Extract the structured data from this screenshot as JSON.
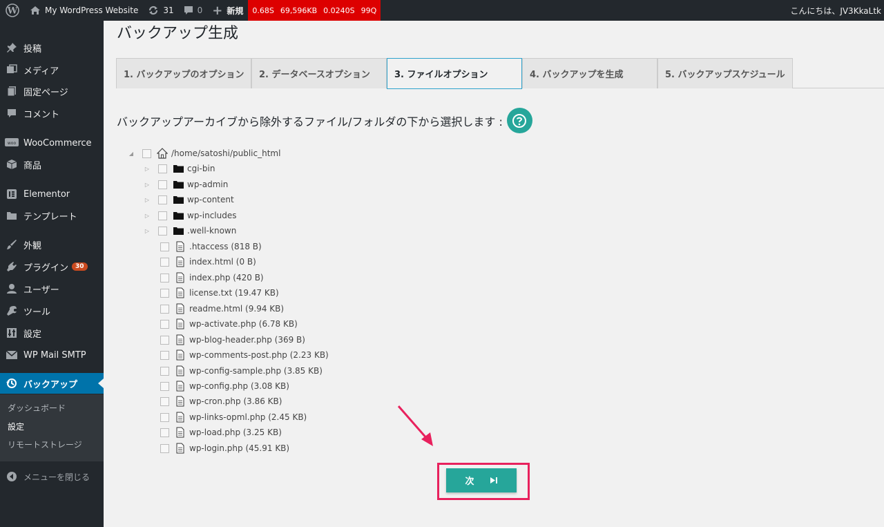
{
  "adminbar": {
    "site_name": "My WordPress Website",
    "updates": "31",
    "comments": "0",
    "new_label": "新規",
    "perf": [
      "0.68S",
      "69,596KB",
      "0.0240S",
      "99Q"
    ],
    "greeting": "こんにちは、JV3KkaLtk"
  },
  "sidebar": {
    "items": [
      {
        "label": "投稿",
        "icon": "pin-icon"
      },
      {
        "label": "メディア",
        "icon": "media-icon"
      },
      {
        "label": "固定ページ",
        "icon": "page-icon"
      },
      {
        "label": "コメント",
        "icon": "comment-icon"
      },
      {
        "label": "WooCommerce",
        "icon": "woo-icon"
      },
      {
        "label": "商品",
        "icon": "box-icon"
      },
      {
        "label": "Elementor",
        "icon": "elementor-icon"
      },
      {
        "label": "テンプレート",
        "icon": "folder-icon"
      },
      {
        "label": "外観",
        "icon": "brush-icon"
      },
      {
        "label": "プラグイン",
        "icon": "plugin-icon",
        "badge": "30"
      },
      {
        "label": "ユーザー",
        "icon": "user-icon"
      },
      {
        "label": "ツール",
        "icon": "wrench-icon"
      },
      {
        "label": "設定",
        "icon": "settings-icon"
      },
      {
        "label": "WP Mail SMTP",
        "icon": "mail-icon"
      },
      {
        "label": "バックアップ",
        "icon": "history-icon"
      }
    ],
    "submenu": [
      "ダッシュボード",
      "設定",
      "リモートストレージ"
    ],
    "collapse": "メニューを閉じる"
  },
  "page": {
    "title": "バックアップ生成",
    "tabs": [
      "1. バックアップのオプション",
      "2. データベースオプション",
      "3. ファイルオプション",
      "4. バックアップを生成",
      "5. バックアップスケジュール"
    ],
    "active_tab": 2,
    "instruction": "バックアップアーカイブから除外するファイル/フォルダの下から選択します :",
    "help_icon": "question-icon",
    "next_label": "次"
  },
  "tree": {
    "root": "/home/satoshi/public_html",
    "folders": [
      "cgi-bin",
      "wp-admin",
      "wp-content",
      "wp-includes",
      ".well-known"
    ],
    "files": [
      ".htaccess (818 B)",
      "index.html (0 B)",
      "index.php (420 B)",
      "license.txt (19.47 KB)",
      "readme.html (9.94 KB)",
      "wp-activate.php (6.78 KB)",
      "wp-blog-header.php (369 B)",
      "wp-comments-post.php (2.23 KB)",
      "wp-config-sample.php (3.85 KB)",
      "wp-config.php (3.08 KB)",
      "wp-cron.php (3.86 KB)",
      "wp-links-opml.php (2.45 KB)",
      "wp-load.php (3.25 KB)",
      "wp-login.php (45.91 KB)"
    ]
  },
  "colors": {
    "adminbar": "#23282d",
    "accent": "#0073aa",
    "teal": "#26a69a",
    "highlight": "#e8215d",
    "perf_bg": "#dd0000"
  }
}
